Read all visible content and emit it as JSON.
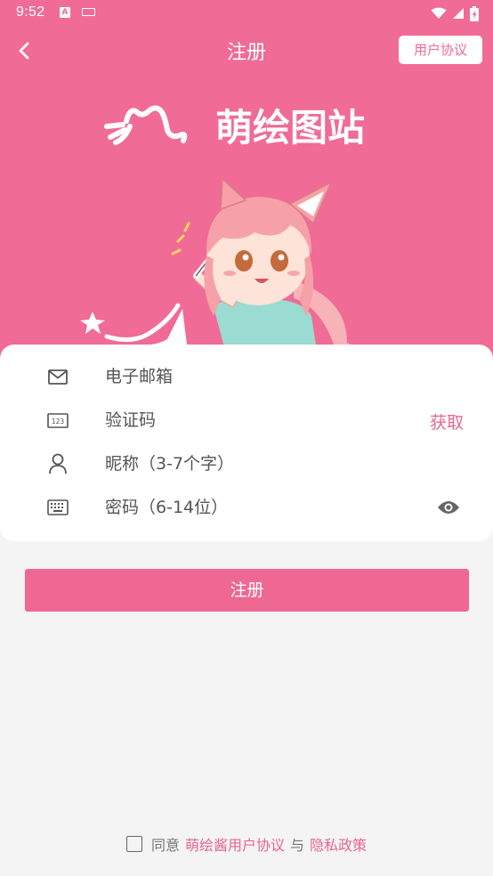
{
  "status_bar": {
    "time": "9:52",
    "notification_icons": [
      "text-a-icon",
      "keyboard-icon"
    ],
    "system_icons": [
      "wifi-icon",
      "signal-icon",
      "battery-icon"
    ]
  },
  "app_bar": {
    "back_icon": "chevron-left-icon",
    "title": "注册",
    "agreement_label": "用户协议"
  },
  "hero": {
    "logo_text": "萌绘图站",
    "background_color": "#f06b95"
  },
  "form": {
    "email": {
      "icon": "mail-icon",
      "placeholder": "电子邮箱",
      "value": ""
    },
    "code": {
      "icon": "numeric-keypad-icon",
      "placeholder": "验证码",
      "value": "",
      "action_label": "获取"
    },
    "nickname": {
      "icon": "person-icon",
      "placeholder": "昵称（3-7个字）",
      "value": ""
    },
    "password": {
      "icon": "keyboard-icon",
      "placeholder": "密码（6-14位）",
      "value": "",
      "toggle_icon": "eye-icon"
    }
  },
  "submit": {
    "label": "注册",
    "color": "#ef6892"
  },
  "footer": {
    "agree": "同意",
    "user_agreement": "萌绘酱用户协议",
    "and": "与",
    "privacy": "隐私政策",
    "checked": false
  },
  "accent_color": "#e8668f"
}
